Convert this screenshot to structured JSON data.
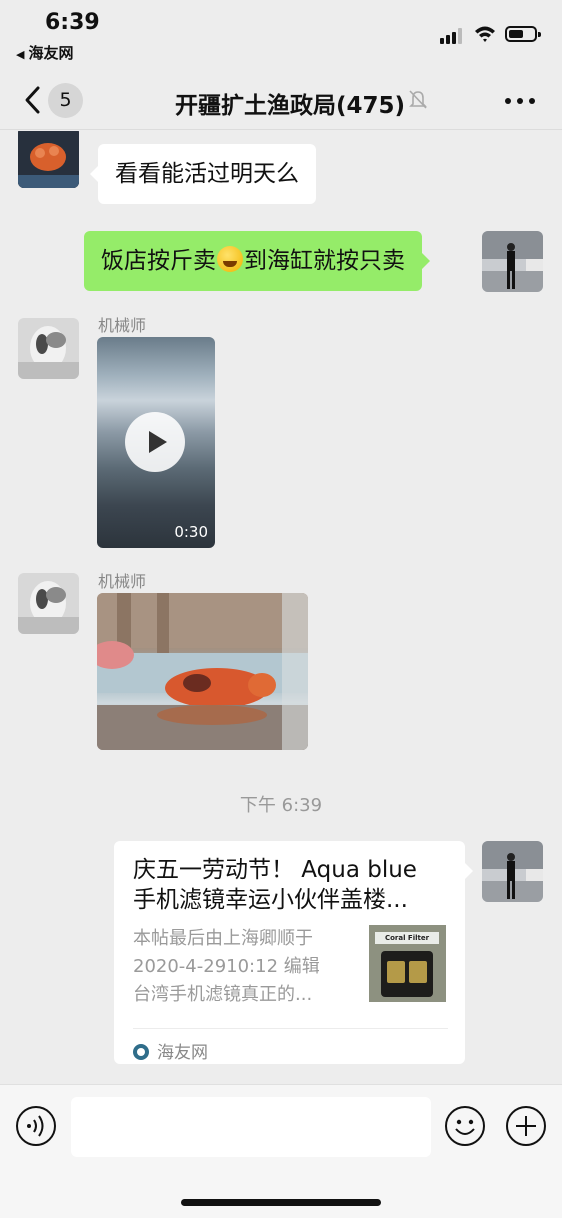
{
  "status_bar": {
    "time": "6:39",
    "back_app": "海友网"
  },
  "nav": {
    "unread_count": "5",
    "title": "开疆扩土渔政局(475)"
  },
  "messages": [
    {
      "type": "text",
      "direction": "in",
      "sender": "",
      "text": "看看能活过明天么"
    },
    {
      "type": "text",
      "direction": "out",
      "text_before_emoji": "饭店按斤卖",
      "emoji": "laughing-crying-emoji",
      "text_after_emoji": "到海缸就按只卖"
    },
    {
      "type": "video",
      "direction": "in",
      "sender": "机械师",
      "duration": "0:30"
    },
    {
      "type": "image",
      "direction": "in",
      "sender": "机械师"
    }
  ],
  "timestamp": "下午 6:39",
  "link_card": {
    "title_line1": "庆五一劳动节！ Aqua blue",
    "title_line2": "手机滤镜幸运小伙伴盖楼...",
    "desc_line1": "本帖最后由上海卿顺于",
    "desc_line2": "2020-4-2910:12 编辑",
    "desc_line3": "台湾手机滤镜真正的...",
    "thumb_label": "Coral Filter",
    "source": "海友网"
  },
  "colors": {
    "outgoing_bubble": "#95ec69",
    "background": "#ededed"
  }
}
